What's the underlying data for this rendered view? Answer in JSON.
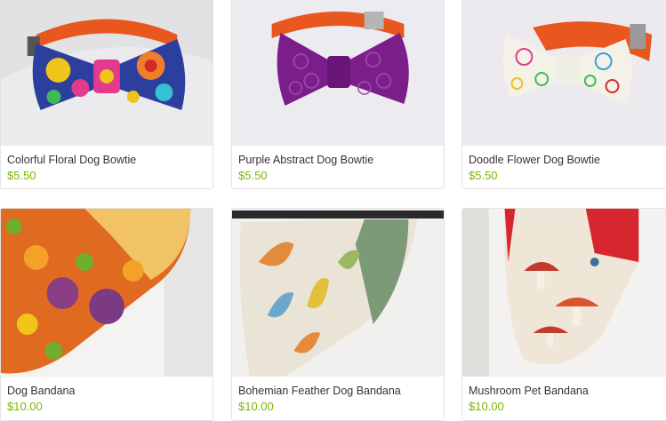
{
  "products": [
    {
      "title": "Colorful Floral Dog Bowtie",
      "price": "$5.50",
      "image_icon": "bowtie-floral-image"
    },
    {
      "title": "Purple Abstract Dog Bowtie",
      "price": "$5.50",
      "image_icon": "bowtie-purple-image"
    },
    {
      "title": "Doodle Flower Dog Bowtie",
      "price": "$5.50",
      "image_icon": "bowtie-doodle-image"
    },
    {
      "title": "Dog Bandana",
      "price": "$10.00",
      "image_icon": "bandana-floral-image"
    },
    {
      "title": "Bohemian Feather Dog Bandana",
      "price": "$10.00",
      "image_icon": "bandana-feather-image"
    },
    {
      "title": "Mushroom Pet Bandana",
      "price": "$10.00",
      "image_icon": "bandana-mushroom-image"
    }
  ],
  "colors": {
    "price": "#7ab800",
    "collar": "#e8571e",
    "purple_bow": "#7b1e8a",
    "mushroom_red": "#d8262e"
  }
}
